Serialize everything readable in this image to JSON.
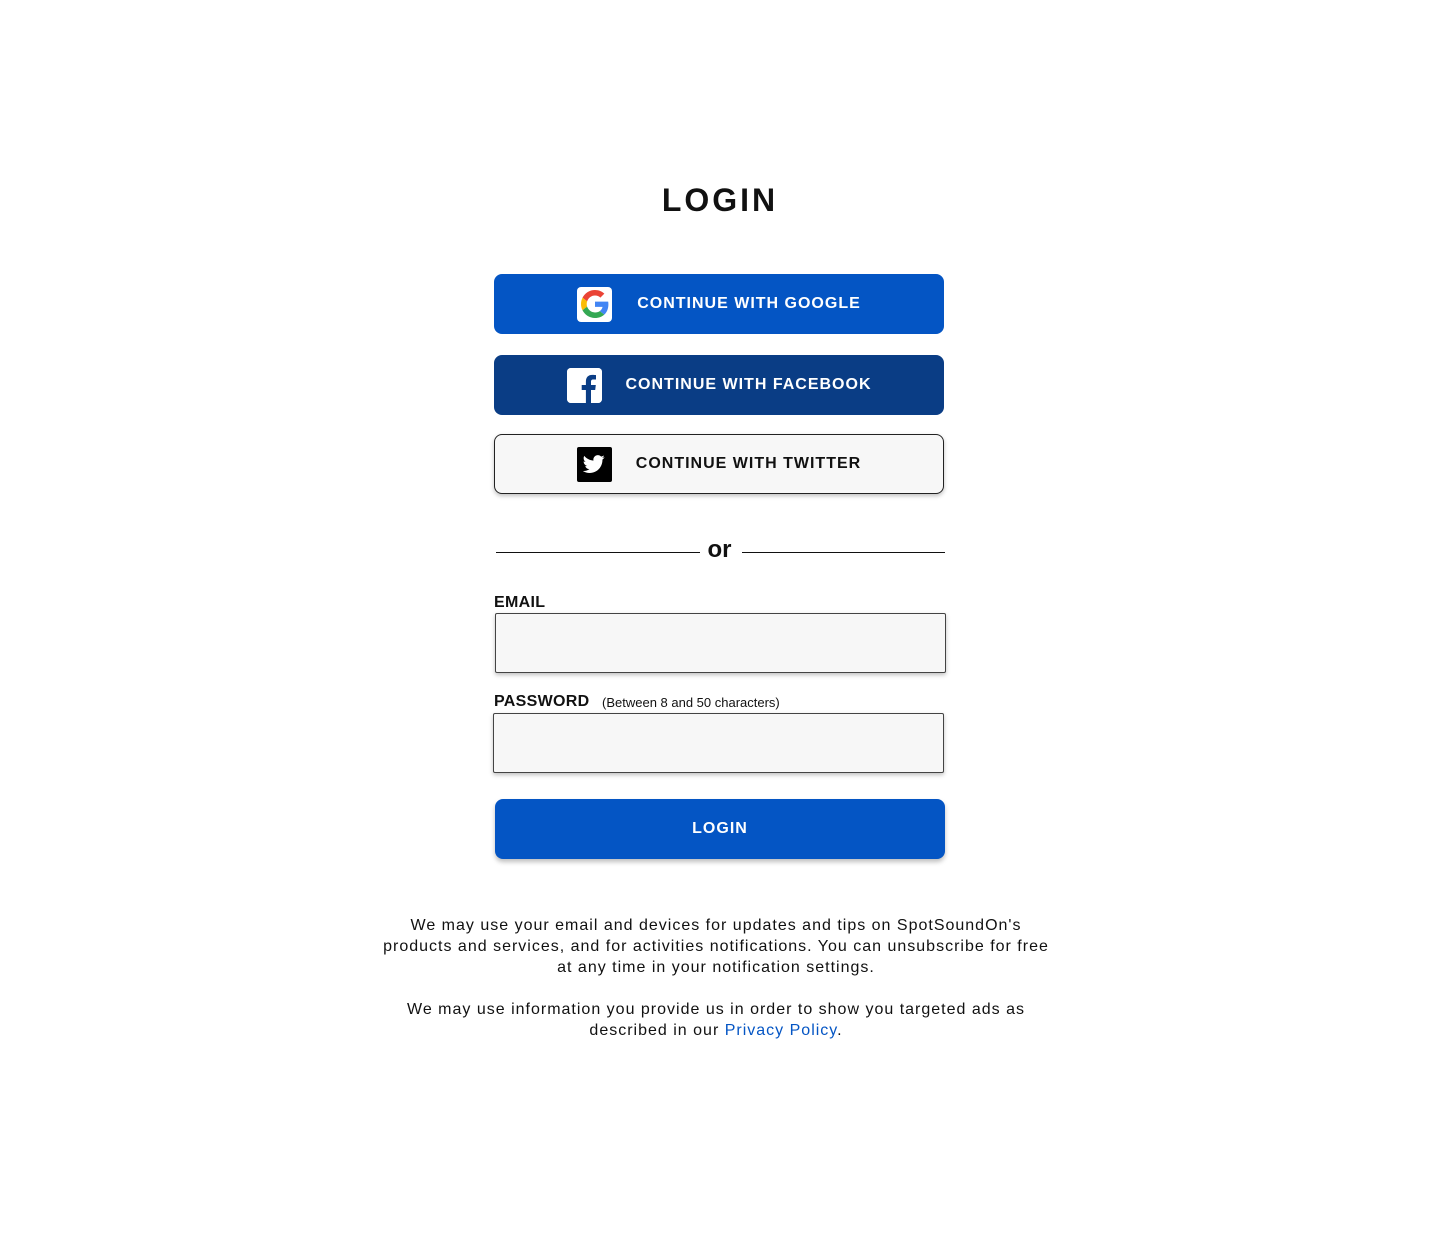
{
  "page": {
    "title": "LOGIN"
  },
  "social": {
    "google": {
      "label": "CONTINUE WITH GOOGLE",
      "icon": "google-icon",
      "color": "#0455c4"
    },
    "facebook": {
      "label": "CONTINUE WITH FACEBOOK",
      "icon": "facebook-icon",
      "color": "#0a3d85"
    },
    "twitter": {
      "label": "CONTINUE WITH TWITTER",
      "icon": "twitter-icon",
      "color": "#f7f7f7"
    }
  },
  "divider": {
    "text": "or"
  },
  "form": {
    "email_label": "EMAIL",
    "email_value": "",
    "password_label": "PASSWORD",
    "password_hint": "(Between 8 and 50 characters)",
    "password_value": "",
    "submit_label": "LOGIN"
  },
  "notice": {
    "paragraph1": "We may use your email and devices for updates and tips on SpotSoundOn's products and services, and for activities notifications. You can unsubscribe for free at any time in your notification settings.",
    "paragraph2_prefix": "We may use information you provide us in order to show you targeted ads as described in our ",
    "privacy_link": "Privacy Policy",
    "paragraph2_suffix": "."
  },
  "colors": {
    "accent": "#0455c4",
    "facebook": "#0a3d85",
    "text": "#111111"
  }
}
